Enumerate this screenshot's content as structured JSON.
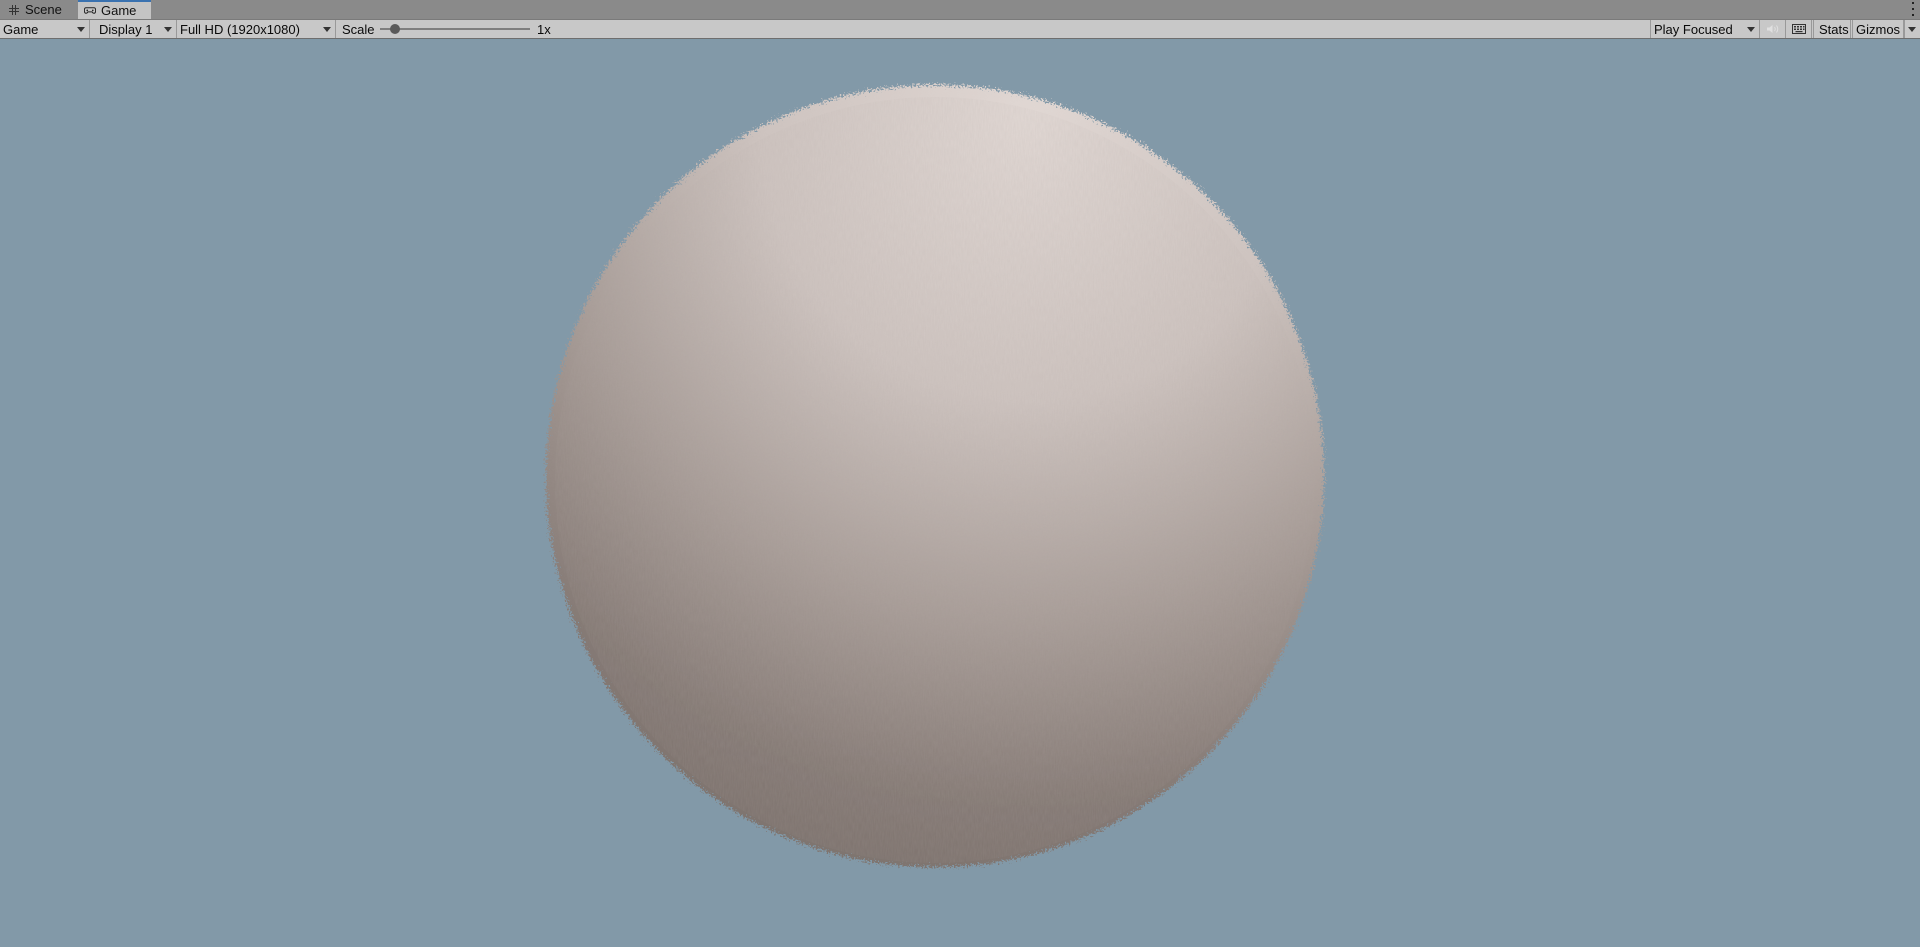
{
  "tabs": [
    {
      "label": "Scene",
      "icon": "grid-icon",
      "active": false
    },
    {
      "label": "Game",
      "icon": "gamepad-icon",
      "active": true
    }
  ],
  "toolbar": {
    "view_mode": "Game",
    "display": "Display 1",
    "resolution": "Full HD (1920x1080)",
    "scale_label": "Scale",
    "scale_value": "1x",
    "scale_level": 0.1,
    "play_mode": "Play Focused",
    "stats_label": "Stats",
    "gizmos_label": "Gizmos"
  },
  "colors": {
    "viewport_background": "#8299a8",
    "sphere_light": "#ddd4d0",
    "sphere_dark": "#7c716b",
    "active_tab_accent": "#3a72b0"
  }
}
